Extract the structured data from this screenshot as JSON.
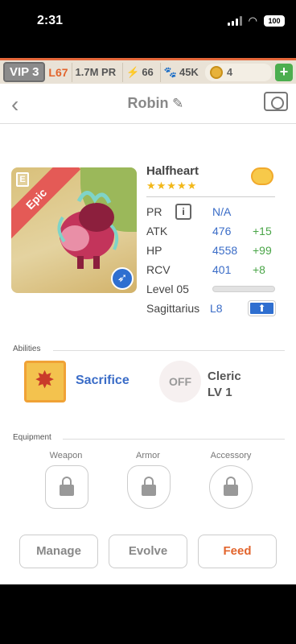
{
  "status": {
    "time": "2:31",
    "battery": "100"
  },
  "topbar": {
    "vip": "VIP 3",
    "level": "L67",
    "power": "1.7M PR",
    "energy": "66",
    "food": "45K",
    "coins": "4",
    "add": "+"
  },
  "header": {
    "title": "Robin"
  },
  "monster": {
    "name": "Halfheart",
    "rarity": "Epic",
    "stars": "★★★★★",
    "stats": {
      "pr_label": "PR",
      "pr_value": "N/A",
      "atk_label": "ATK",
      "atk_value": "476",
      "atk_bonus": "+15",
      "hp_label": "HP",
      "hp_value": "4558",
      "hp_bonus": "+99",
      "rcv_label": "RCV",
      "rcv_value": "401",
      "rcv_bonus": "+8",
      "level_label": "Level 05",
      "level_progress": 0.02,
      "sign": "Sagittarius",
      "sign_level": "L8"
    }
  },
  "abilities": {
    "label": "Abilities",
    "primary": "Sacrifice",
    "secondary_off": "OFF",
    "secondary_name": "Cleric",
    "secondary_level": "LV 1"
  },
  "equipment": {
    "label": "Equipment",
    "slots": [
      "Weapon",
      "Armor",
      "Accessory"
    ]
  },
  "actions": {
    "manage": "Manage",
    "evolve": "Evolve",
    "feed": "Feed"
  },
  "colors": {
    "accent": "#e2642c",
    "link": "#3a6cc7",
    "bonus": "#4aa548"
  }
}
